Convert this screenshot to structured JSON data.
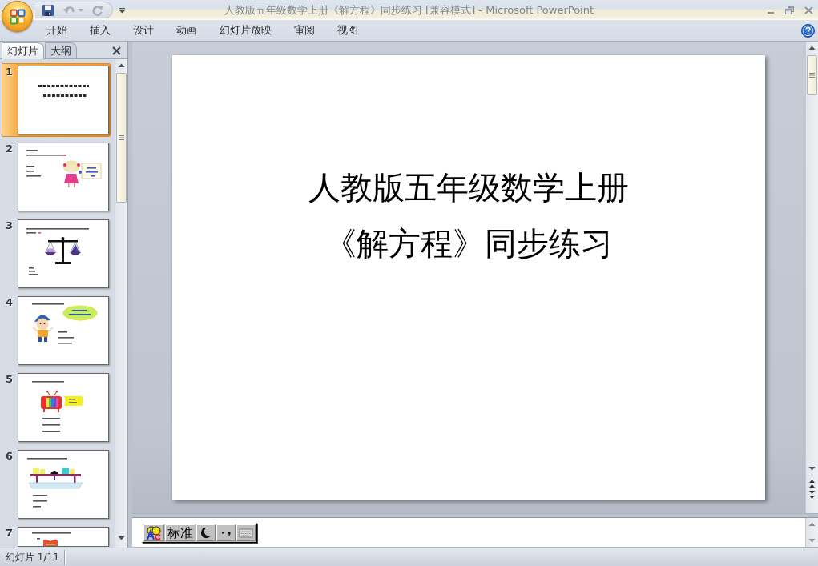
{
  "window": {
    "title": "人教版五年级数学上册《解方程》同步练习 [兼容模式] - Microsoft PowerPoint"
  },
  "quick_access": [
    {
      "kind": "save",
      "disabled": false
    },
    {
      "kind": "undo",
      "disabled": true
    },
    {
      "kind": "redo",
      "disabled": true
    }
  ],
  "ribbon_tabs": [
    {
      "label": "开始",
      "selected": false
    },
    {
      "label": "插入",
      "selected": false
    },
    {
      "label": "设计",
      "selected": false
    },
    {
      "label": "动画",
      "selected": false
    },
    {
      "label": "幻灯片放映",
      "selected": false
    },
    {
      "label": "审阅",
      "selected": false
    },
    {
      "label": "视图",
      "selected": false
    }
  ],
  "slide_panel": {
    "tabs": [
      {
        "label": "幻灯片",
        "selected": true
      },
      {
        "label": "大纲",
        "selected": false
      }
    ],
    "slides": [
      {
        "number": "1",
        "kind": "title",
        "selected": true
      },
      {
        "number": "2",
        "kind": "girl",
        "selected": false
      },
      {
        "number": "3",
        "kind": "scale",
        "selected": false
      },
      {
        "number": "4",
        "kind": "boy",
        "selected": false
      },
      {
        "number": "5",
        "kind": "tv",
        "selected": false
      },
      {
        "number": "6",
        "kind": "balance",
        "selected": false
      },
      {
        "number": "7",
        "kind": "heart",
        "selected": false
      }
    ]
  },
  "slide": {
    "title_lines": [
      "人教版五年级数学上册",
      "《解方程》同步练习"
    ]
  },
  "ime_toolbar": {
    "mode": "标准"
  },
  "status_bar": {
    "slide_indicator": "幻灯片 1/11"
  }
}
